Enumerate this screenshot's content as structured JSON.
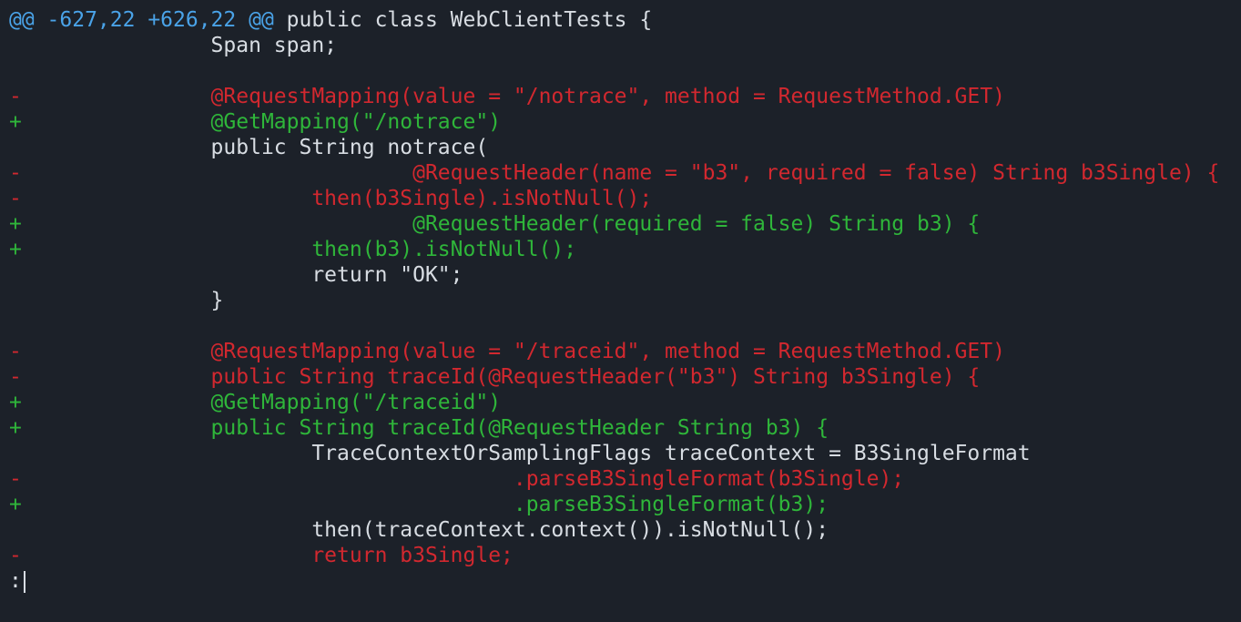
{
  "hunk": {
    "range": "@@ -627,22 +626,22 @@",
    "context": " public class WebClientTests {"
  },
  "lines": [
    {
      "type": "context",
      "prefix": " ",
      "text": "                Span span;"
    },
    {
      "type": "context",
      "prefix": " ",
      "text": ""
    },
    {
      "type": "removed",
      "prefix": "-",
      "text": "                @RequestMapping(value = \"/notrace\", method = RequestMethod.GET)"
    },
    {
      "type": "added",
      "prefix": "+",
      "text": "                @GetMapping(\"/notrace\")"
    },
    {
      "type": "context",
      "prefix": " ",
      "text": "                public String notrace("
    },
    {
      "type": "removed",
      "prefix": "-",
      "text": "                                @RequestHeader(name = \"b3\", required = false) String b3Single) {"
    },
    {
      "type": "removed",
      "prefix": "-",
      "text": "                        then(b3Single).isNotNull();"
    },
    {
      "type": "added",
      "prefix": "+",
      "text": "                                @RequestHeader(required = false) String b3) {"
    },
    {
      "type": "added",
      "prefix": "+",
      "text": "                        then(b3).isNotNull();"
    },
    {
      "type": "context",
      "prefix": " ",
      "text": "                        return \"OK\";"
    },
    {
      "type": "context",
      "prefix": " ",
      "text": "                }"
    },
    {
      "type": "context",
      "prefix": " ",
      "text": ""
    },
    {
      "type": "removed",
      "prefix": "-",
      "text": "                @RequestMapping(value = \"/traceid\", method = RequestMethod.GET)"
    },
    {
      "type": "removed",
      "prefix": "-",
      "text": "                public String traceId(@RequestHeader(\"b3\") String b3Single) {"
    },
    {
      "type": "added",
      "prefix": "+",
      "text": "                @GetMapping(\"/traceid\")"
    },
    {
      "type": "added",
      "prefix": "+",
      "text": "                public String traceId(@RequestHeader String b3) {"
    },
    {
      "type": "context",
      "prefix": " ",
      "text": "                        TraceContextOrSamplingFlags traceContext = B3SingleFormat"
    },
    {
      "type": "removed",
      "prefix": "-",
      "text": "                                        .parseB3SingleFormat(b3Single);"
    },
    {
      "type": "added",
      "prefix": "+",
      "text": "                                        .parseB3SingleFormat(b3);"
    },
    {
      "type": "context",
      "prefix": " ",
      "text": "                        then(traceContext.context()).isNotNull();"
    },
    {
      "type": "removed",
      "prefix": "-",
      "text": "                        return b3Single;"
    }
  ],
  "prompt": {
    "text": ":"
  }
}
